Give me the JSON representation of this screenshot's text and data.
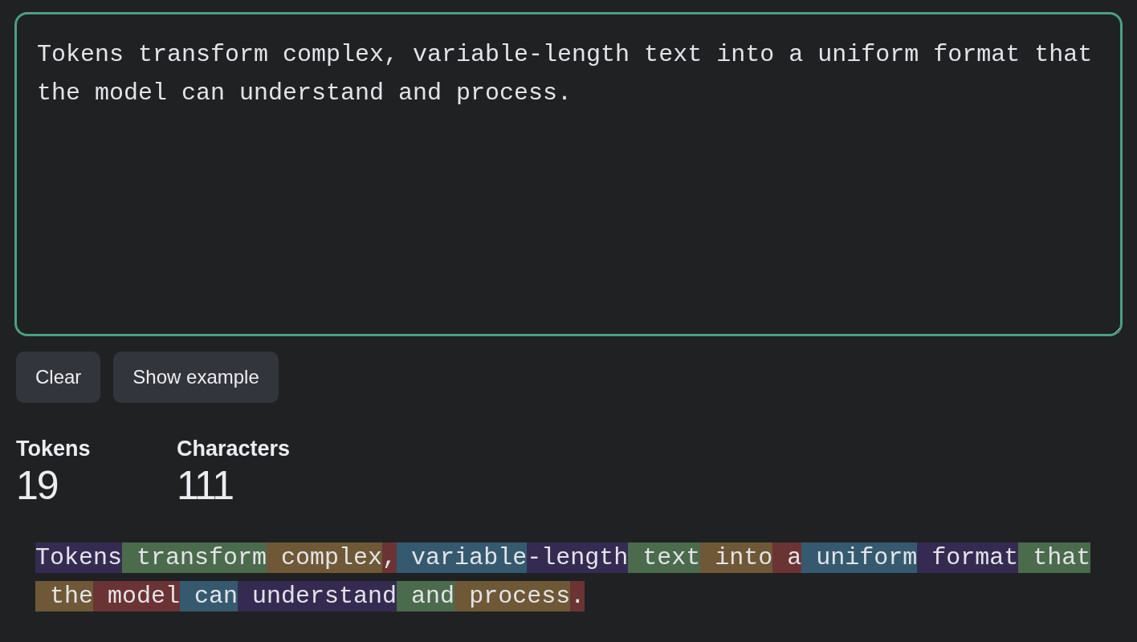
{
  "input": {
    "value": "Tokens transform complex, variable-length text into a uniform format that the model can understand and process."
  },
  "buttons": [
    "Clear",
    "Show example"
  ],
  "stats": [
    {
      "label": "Tokens",
      "value": "19"
    },
    {
      "label": "Characters",
      "value": "111"
    }
  ],
  "tokens": [
    {
      "text": "Tokens",
      "color": "#352b52"
    },
    {
      "text": " transform",
      "color": "#4a6b4c"
    },
    {
      "text": " complex",
      "color": "#6e5836"
    },
    {
      "text": ",",
      "color": "#6b3333"
    },
    {
      "text": " variable",
      "color": "#355a70"
    },
    {
      "text": "-length",
      "color": "#352b52"
    },
    {
      "text": " text",
      "color": "#4a6b4c"
    },
    {
      "text": " into",
      "color": "#6e5836"
    },
    {
      "text": " a",
      "color": "#6b3333"
    },
    {
      "text": " uniform",
      "color": "#355a70"
    },
    {
      "text": " format",
      "color": "#352b52"
    },
    {
      "text": " that",
      "color": "#4a6b4c"
    },
    {
      "text": " the",
      "color": "#6e5836"
    },
    {
      "text": " model",
      "color": "#6b3333"
    },
    {
      "text": " can",
      "color": "#355a70"
    },
    {
      "text": " understand",
      "color": "#352b52"
    },
    {
      "text": " and",
      "color": "#4a6b4c"
    },
    {
      "text": " process",
      "color": "#6e5836"
    },
    {
      "text": ".",
      "color": "#6b3333"
    }
  ]
}
